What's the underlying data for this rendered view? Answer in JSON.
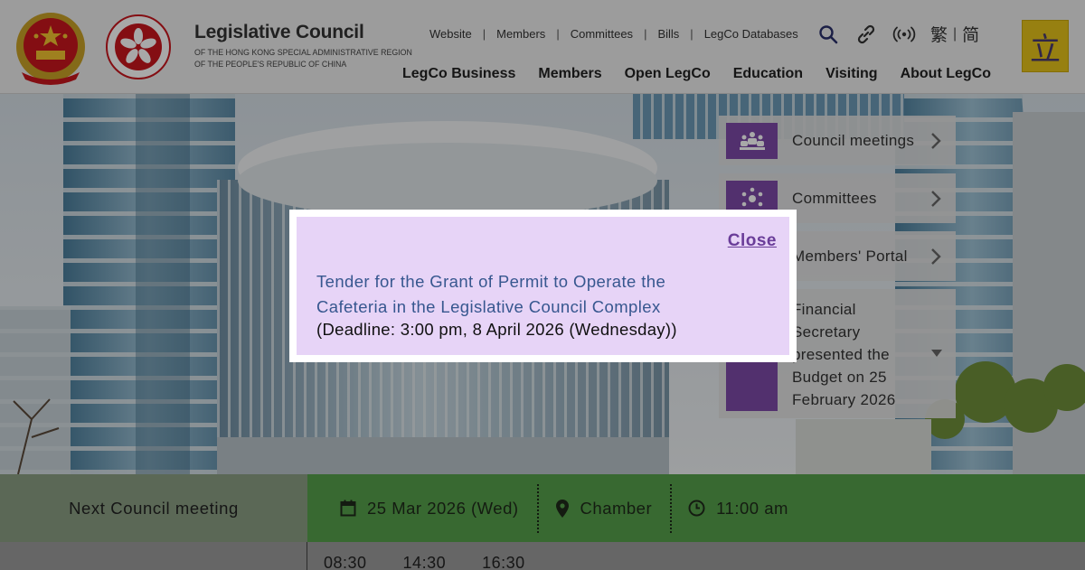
{
  "header": {
    "org_name": "Legislative Council",
    "org_sub_line1": "OF THE HONG KONG SPECIAL ADMINISTRATIVE REGION",
    "org_sub_line2": "OF THE PEOPLE'S REPUBLIC OF CHINA",
    "top_links": [
      "Website",
      "Members",
      "Committees",
      "Bills",
      "LegCo Databases"
    ],
    "separator": "|",
    "icons": [
      "search-icon",
      "link-icon",
      "broadcast-icon"
    ],
    "lang_traditional": "繁",
    "lang_simplified": "简",
    "lang_separator": "|",
    "logo_char": "立",
    "main_nav": [
      "LegCo Business",
      "Members",
      "Open LegCo",
      "Education",
      "Visiting",
      "About LegCo"
    ]
  },
  "quick_links": [
    {
      "label": "Council meetings",
      "icon": "council-meetings-icon"
    },
    {
      "label": "Committees",
      "icon": "committees-icon"
    },
    {
      "label": "Members' Portal",
      "icon": "members-portal-icon"
    }
  ],
  "news_item": {
    "line1": "Financial",
    "line2": "Secretary",
    "line3": "presented the",
    "line4": "Budget on 25",
    "line5": "February 2026"
  },
  "modal": {
    "close_label": "Close",
    "link_text": "Tender for the Grant of Permit to Operate the Cafeteria in the Legislative Council Complex",
    "deadline": "(Deadline: 3:00 pm, 8 April 2026 (Wednesday))"
  },
  "next_meeting": {
    "label": "Next Council meeting",
    "date": "25 Mar 2026 (Wed)",
    "venue": "Chamber",
    "time": "11:00 am"
  },
  "schedule_times": [
    "08:30",
    "14:30",
    "16:30"
  ],
  "colors": {
    "purple": "#7d4aa8",
    "green": "#56a04b",
    "modal_bg": "#e7d4f7",
    "logo_yellow": "#e6c21a"
  }
}
